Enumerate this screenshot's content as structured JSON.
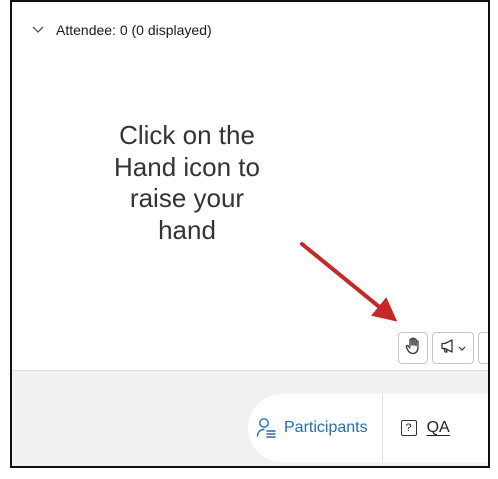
{
  "attendee_panel": {
    "header": "Attendee: 0 (0 displayed)"
  },
  "instruction": {
    "text": "Click on the\nHand icon to\nraise your\nhand",
    "arrow_color": "#c62828"
  },
  "toolbar": {
    "hand_icon": "raise-hand-icon",
    "speaker_icon": "megaphone-icon",
    "more_label": "!"
  },
  "footer": {
    "participants_label": "Participants",
    "qa_icon_label": "?",
    "qa_label": "QA",
    "participants_color": "#1f6fb6"
  }
}
